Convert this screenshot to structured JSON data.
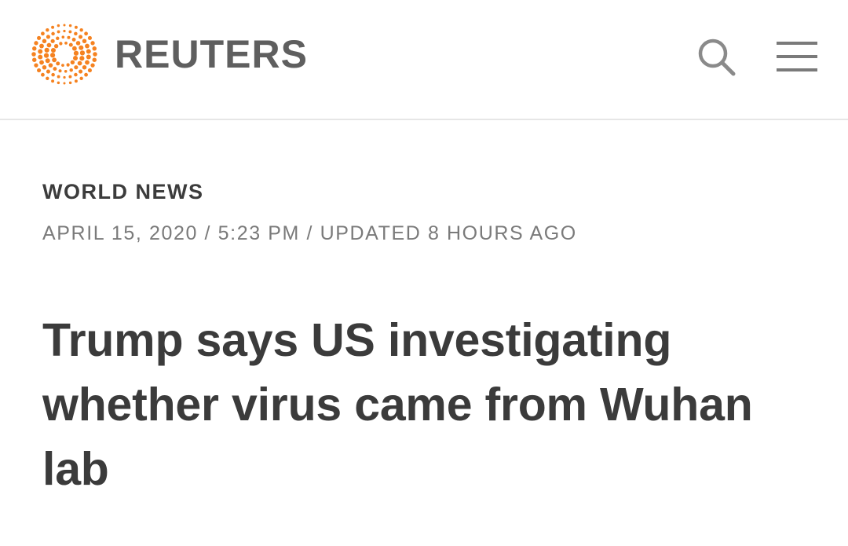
{
  "header": {
    "brand": "REUTERS",
    "logo_icon": "reuters-dot-sphere-icon",
    "brand_color": "#f58220",
    "search_icon": "search-icon",
    "menu_icon": "hamburger-menu-icon"
  },
  "article": {
    "section": "WORLD NEWS",
    "date": "APRIL 15, 2020",
    "time": "5:23 PM",
    "updated": "UPDATED 8 HOURS AGO",
    "separator": " / ",
    "headline": "Trump says US investigating whether virus came from Wuhan lab"
  }
}
